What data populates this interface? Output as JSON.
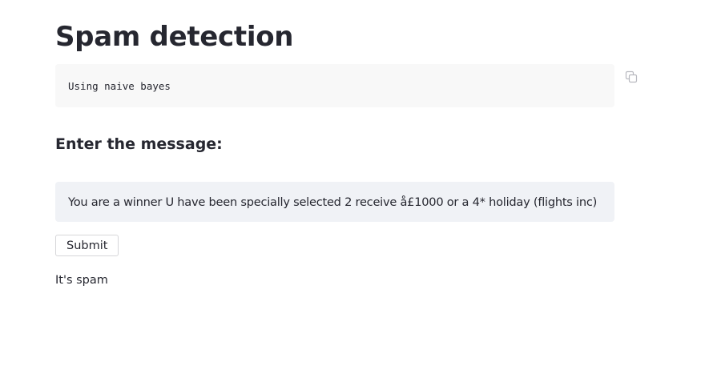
{
  "page": {
    "title": "Spam detection",
    "code_block": {
      "text": "Using naive bayes",
      "copy_icon": "copy-icon"
    },
    "input_label": "Enter the message:",
    "message_value": "You are a winner U have been specially selected 2 receive å£1000 or a 4* holiday (flights inc)",
    "submit_label": "Submit",
    "result_text": "It's spam"
  },
  "colors": {
    "text": "#262730",
    "code_background": "#f8f8f8",
    "input_background": "#f0f2f6",
    "button_border": "#d6d6d9",
    "icon": "#b8b9c0"
  }
}
